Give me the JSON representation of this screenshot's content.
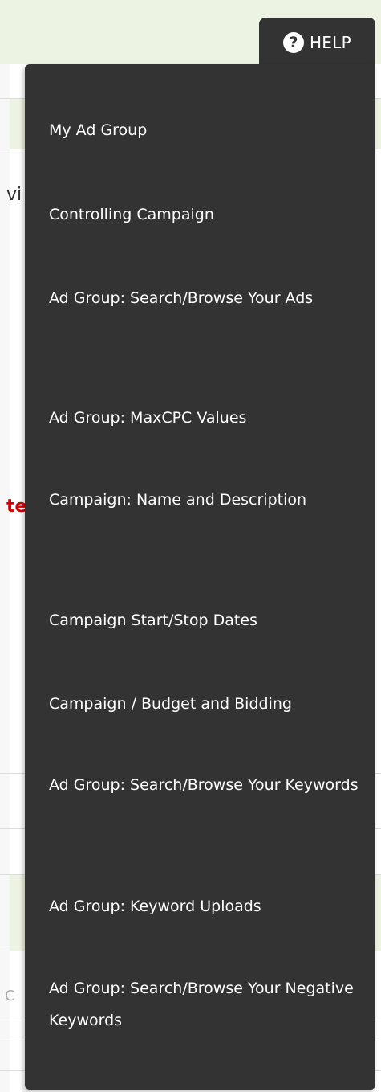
{
  "background": {
    "fragment_vi": "vi",
    "fragment_te": "te",
    "fragment_c": "C"
  },
  "help": {
    "label": "HELP",
    "icon": "question-circle-icon"
  },
  "menu": {
    "items": [
      {
        "label": "My Ad Group"
      },
      {
        "label": "Controlling Campaign"
      },
      {
        "label": "Ad Group: Search/Browse Your Ads"
      },
      {
        "label": "Ad Group: MaxCPC Values"
      },
      {
        "label": "Campaign: Name and Description"
      },
      {
        "label": "Campaign Start/Stop Dates"
      },
      {
        "label": "Campaign / Budget and Bidding"
      },
      {
        "label": "Ad Group: Search/Browse Your Keywords"
      },
      {
        "label": "Ad Group: Keyword Uploads"
      },
      {
        "label": "Ad Group: Search/Browse Your Negative Keywords"
      }
    ]
  },
  "colors": {
    "menu_background": "#333333",
    "menu_text": "#ffffff",
    "page_header_background": "#edf3e3",
    "warning_text": "#d40000"
  }
}
